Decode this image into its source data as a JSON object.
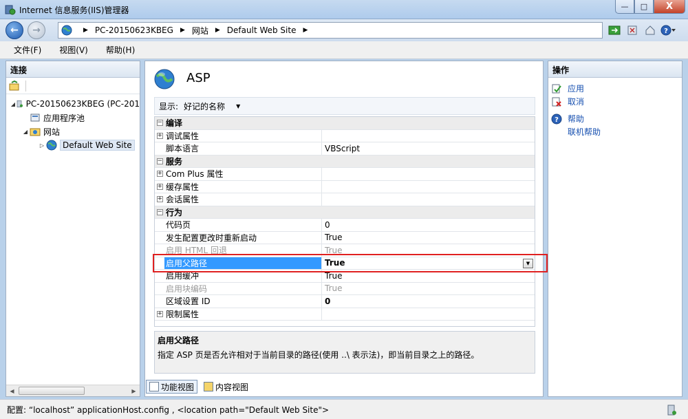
{
  "window": {
    "title": "Internet 信息服务(IIS)管理器",
    "controls": {
      "minimize": "—",
      "maximize": "□",
      "close": "X"
    }
  },
  "address": {
    "crumbs": [
      "PC-20150623KBEG",
      "网站",
      "Default Web Site"
    ]
  },
  "menu": [
    "文件(F)",
    "视图(V)",
    "帮助(H)"
  ],
  "connections": {
    "header": "连接",
    "tree": [
      {
        "label": "PC-20150623KBEG (PC-201",
        "level": 0,
        "icon": "server-icon"
      },
      {
        "label": "应用程序池",
        "level": 1,
        "icon": "app-pool-icon"
      },
      {
        "label": "网站",
        "level": 1,
        "icon": "sites-folder-icon"
      },
      {
        "label": "Default Web Site",
        "level": 2,
        "icon": "globe-icon"
      }
    ]
  },
  "feature": {
    "title": "ASP",
    "show_label": "显示:",
    "show_value": "好记的名称",
    "rows": [
      {
        "type": "cat",
        "name": "编译"
      },
      {
        "type": "group",
        "name": "调试属性",
        "value": ""
      },
      {
        "type": "prop",
        "name": "脚本语言",
        "value": "VBScript"
      },
      {
        "type": "cat",
        "name": "服务"
      },
      {
        "type": "group",
        "name": "Com Plus 属性",
        "value": ""
      },
      {
        "type": "group",
        "name": "缓存属性",
        "value": ""
      },
      {
        "type": "group",
        "name": "会话属性",
        "value": ""
      },
      {
        "type": "cat",
        "name": "行为"
      },
      {
        "type": "prop",
        "name": "代码页",
        "value": "0"
      },
      {
        "type": "prop",
        "name": "发生配置更改时重新启动",
        "value": "True"
      },
      {
        "type": "disabled",
        "name": "启用 HTML 回退",
        "value": "True"
      },
      {
        "type": "selected",
        "name": "启用父路径",
        "value": "True"
      },
      {
        "type": "prop",
        "name": "启用缓冲",
        "value": "True"
      },
      {
        "type": "disabled",
        "name": "启用块编码",
        "value": "True"
      },
      {
        "type": "boldval",
        "name": "区域设置 ID",
        "value": "0"
      },
      {
        "type": "group",
        "name": "限制属性",
        "value": ""
      }
    ],
    "description": {
      "title": "启用父路径",
      "text": "指定 ASP 页是否允许相对于当前目录的路径(使用 ..\\ 表示法)，即当前目录之上的路径。"
    },
    "tabs": [
      "功能视图",
      "内容视图"
    ]
  },
  "actions": {
    "header": "操作",
    "items": [
      {
        "label": "应用",
        "icon": "apply-icon"
      },
      {
        "label": "取消",
        "icon": "cancel-icon"
      }
    ],
    "help": [
      {
        "label": "帮助",
        "icon": "help-icon"
      },
      {
        "label": "联机帮助",
        "icon": ""
      }
    ]
  },
  "status": {
    "text": "配置: “localhost”  applicationHost.config , <location path=\"Default Web Site\">"
  },
  "colors": {
    "selection": "#3399ff",
    "link": "#1750b0",
    "highlight": "#e02020"
  }
}
